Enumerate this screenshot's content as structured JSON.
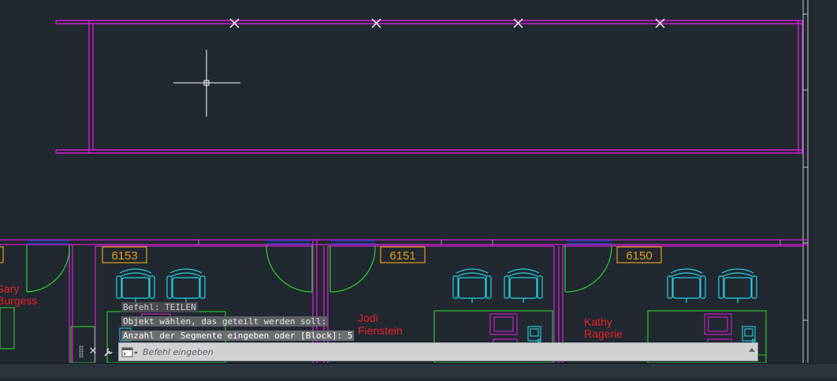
{
  "colors": {
    "canvas_bg": "#212830",
    "wall": "#d41ed4",
    "door": "#2bd12b",
    "furniture_cyan": "#22d3e8",
    "desk_green": "#2bd12b",
    "room_tag": "#e0a018",
    "name_text": "#e8212b",
    "window_blue": "#2c3fc8",
    "crosshair": "#ffffff",
    "divide_marker": "#ffffff"
  },
  "drawing": {
    "rooms": [
      {
        "number": "6153"
      },
      {
        "number": "6151"
      },
      {
        "number": "6150"
      }
    ],
    "occupants": [
      {
        "first": "Gary",
        "last": "Burgess"
      },
      {
        "first": "Jodi",
        "last": "Fienstein"
      },
      {
        "first": "Kathy",
        "last": "Ragerie"
      }
    ],
    "divide_markers": 4
  },
  "command": {
    "history": [
      "Befehl: TEILEN",
      "Objekt wählen, das geteilt werden soll:",
      "Anzahl der Segmente eingeben oder [Block]: 5"
    ],
    "input_placeholder": "Befehl eingeben",
    "close_icon": "close-icon",
    "customize_icon": "wrench-icon",
    "prompt_icon": "command-prompt-icon"
  }
}
